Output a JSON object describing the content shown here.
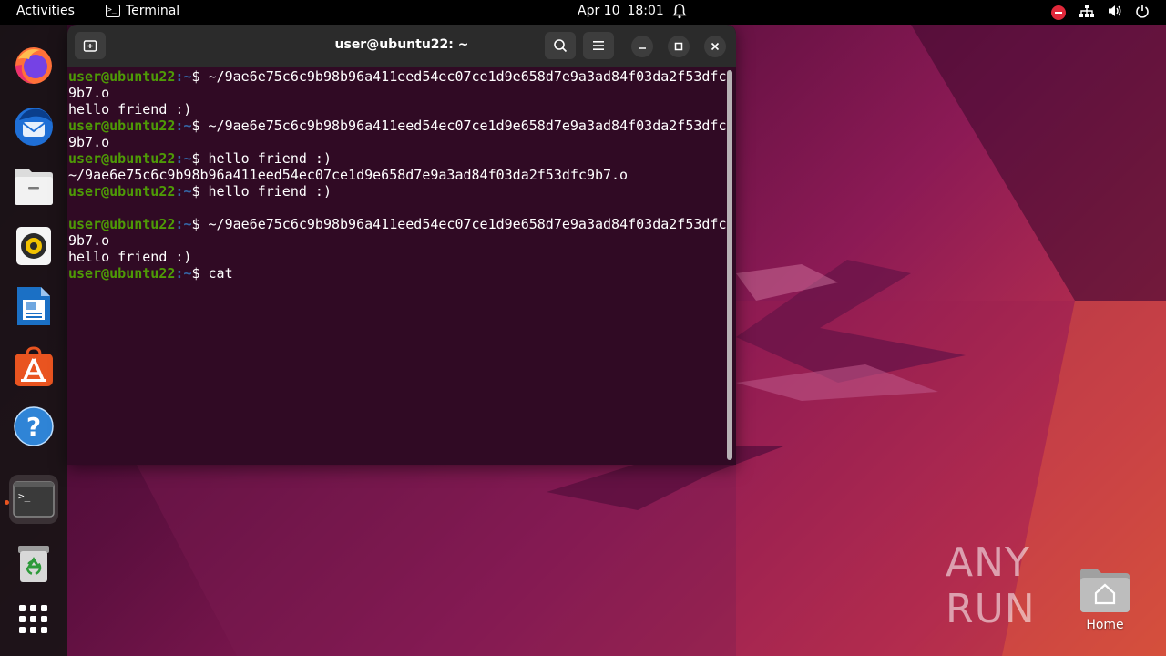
{
  "topbar": {
    "activities": "Activities",
    "app_name": "Terminal",
    "date": "Apr 10",
    "time": "18:01"
  },
  "dock": {
    "items": [
      {
        "name": "firefox-icon"
      },
      {
        "name": "thunderbird-icon"
      },
      {
        "name": "files-icon"
      },
      {
        "name": "rhythmbox-icon"
      },
      {
        "name": "libreoffice-writer-icon"
      },
      {
        "name": "app-center-icon"
      },
      {
        "name": "help-icon"
      },
      {
        "name": "terminal-icon"
      },
      {
        "name": "trash-icon"
      },
      {
        "name": "show-apps-icon"
      }
    ]
  },
  "terminal": {
    "title": "user@ubuntu22: ~",
    "prompt_user": "user@ubuntu22",
    "prompt_path": ":~",
    "prompt_symbol": "$ ",
    "lines": [
      {
        "prompt": true,
        "text": "~/9ae6e75c6c9b98b96a411eed54ec07ce1d9e658d7e9a3ad84f03da2f53dfc"
      },
      {
        "prompt": false,
        "text": "9b7.o"
      },
      {
        "prompt": false,
        "text": "hello friend :)"
      },
      {
        "prompt": true,
        "text": "~/9ae6e75c6c9b98b96a411eed54ec07ce1d9e658d7e9a3ad84f03da2f53dfc"
      },
      {
        "prompt": false,
        "text": "9b7.o"
      },
      {
        "prompt": true,
        "text": "hello friend :)"
      },
      {
        "prompt": false,
        "text": "~/9ae6e75c6c9b98b96a411eed54ec07ce1d9e658d7e9a3ad84f03da2f53dfc9b7.o"
      },
      {
        "prompt": true,
        "text": "hello friend :)"
      },
      {
        "prompt": false,
        "text": ""
      },
      {
        "prompt": true,
        "text": "~/9ae6e75c6c9b98b96a411eed54ec07ce1d9e658d7e9a3ad84f03da2f53dfc"
      },
      {
        "prompt": false,
        "text": "9b7.o"
      },
      {
        "prompt": false,
        "text": "hello friend :)"
      },
      {
        "prompt": true,
        "text": "cat"
      }
    ]
  },
  "desktop": {
    "home_label": "Home"
  },
  "watermark": {
    "text": "ANY RUN"
  },
  "colors": {
    "terminal_bg": "#300a24",
    "prompt_user": "#4e9a06",
    "prompt_path": "#3465a4",
    "accent": "#e95420"
  }
}
